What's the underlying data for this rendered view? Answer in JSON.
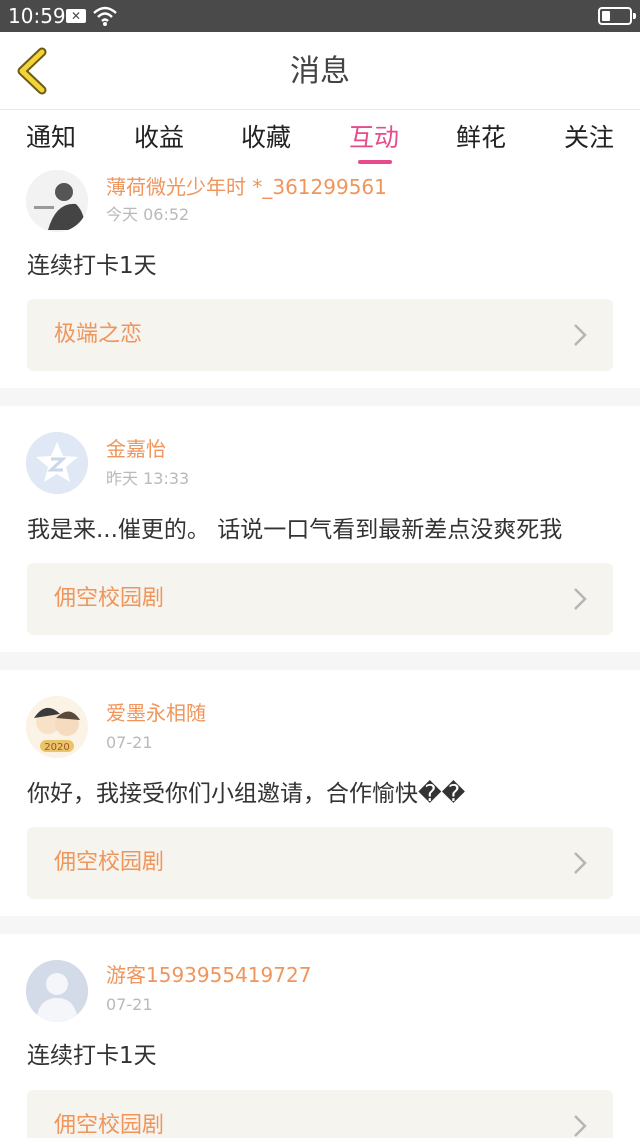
{
  "status_bar": {
    "time": "10:59"
  },
  "header": {
    "title": "消息"
  },
  "tabs": [
    {
      "label": "通知"
    },
    {
      "label": "收益"
    },
    {
      "label": "收藏"
    },
    {
      "label": "互动",
      "active": true
    },
    {
      "label": "鲜花"
    },
    {
      "label": "关注"
    }
  ],
  "messages": [
    {
      "user": "薄荷微光少年时 *_361299561",
      "time": "今天 06:52",
      "text": "连续打卡1天",
      "work": "极端之恋"
    },
    {
      "user": "金嘉怡",
      "time": "昨天 13:33",
      "text": "我是来...催更的。 话说一口气看到最新差点没爽死我",
      "work": "佣空校园剧"
    },
    {
      "user": "爱墨永相随",
      "time": "07-21",
      "text": "你好，我接受你们小组邀请，合作愉快��",
      "work": "佣空校园剧"
    },
    {
      "user": "游客1593955419727",
      "time": "07-21",
      "text": "连续打卡1天",
      "work": "佣空校园剧"
    }
  ],
  "colors": {
    "accent": "#e84b8a",
    "username": "#f0955b",
    "card_bg": "#f5f4ee"
  }
}
